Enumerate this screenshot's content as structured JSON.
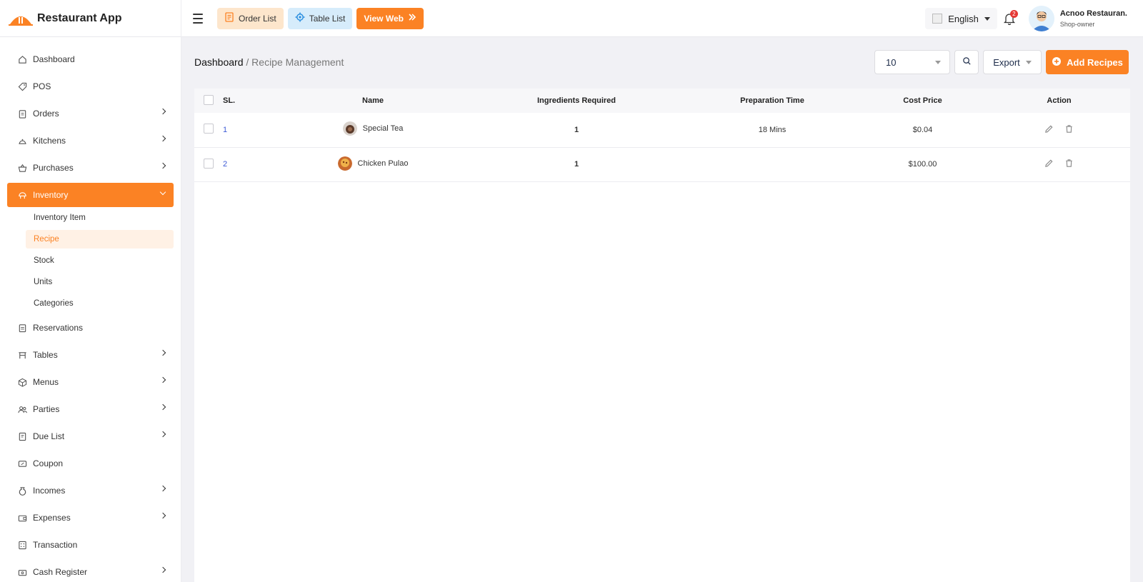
{
  "app": {
    "name": "Restaurant App"
  },
  "header": {
    "order_list": "Order List",
    "table_list": "Table List",
    "view_web": "View Web",
    "language": "English",
    "notification_count": "2",
    "user_name": "Acnoo Restauran.",
    "user_role": "Shop-owner"
  },
  "sidebar": {
    "items": [
      {
        "label": "Dashboard",
        "icon": "home-icon"
      },
      {
        "label": "POS",
        "icon": "tag-icon"
      },
      {
        "label": "Orders",
        "icon": "clipboard-icon"
      },
      {
        "label": "Kitchens",
        "icon": "cooking-pot-icon"
      },
      {
        "label": "Purchases",
        "icon": "basket-icon"
      },
      {
        "label": "Inventory",
        "icon": "inventory-icon"
      },
      {
        "label": "Reservations",
        "icon": "calendar-icon"
      },
      {
        "label": "Tables",
        "icon": "table-icon"
      },
      {
        "label": "Menus",
        "icon": "box-icon"
      },
      {
        "label": "Parties",
        "icon": "users-icon"
      },
      {
        "label": "Due List",
        "icon": "due-list-icon"
      },
      {
        "label": "Coupon",
        "icon": "ticket-icon"
      },
      {
        "label": "Incomes",
        "icon": "money-bag-icon"
      },
      {
        "label": "Expenses",
        "icon": "wallet-icon"
      },
      {
        "label": "Transaction",
        "icon": "transaction-icon"
      },
      {
        "label": "Cash Register",
        "icon": "cash-register-icon"
      }
    ],
    "inventory_sub": [
      "Inventory Item",
      "Recipe",
      "Stock",
      "Units",
      "Categories"
    ]
  },
  "breadcrumb": {
    "home": "Dashboard",
    "separator": " / ",
    "current": "Recipe Management"
  },
  "toolbar": {
    "per_page": "10",
    "export": "Export",
    "add": "Add Recipes"
  },
  "table": {
    "columns": [
      "SL.",
      "Name",
      "Ingredients Required",
      "Preparation Time",
      "Cost Price",
      "Action"
    ],
    "rows": [
      {
        "sl": "1",
        "name": "Special Tea",
        "ingredients": "1",
        "prep_time": "18 Mins",
        "cost": "$0.04"
      },
      {
        "sl": "2",
        "name": "Chicken Pulao",
        "ingredients": "1",
        "prep_time": "",
        "cost": "$100.00"
      }
    ]
  },
  "colors": {
    "accent": "#fb8224",
    "accent_soft": "#fff1e5",
    "link": "#3d5bd6"
  }
}
